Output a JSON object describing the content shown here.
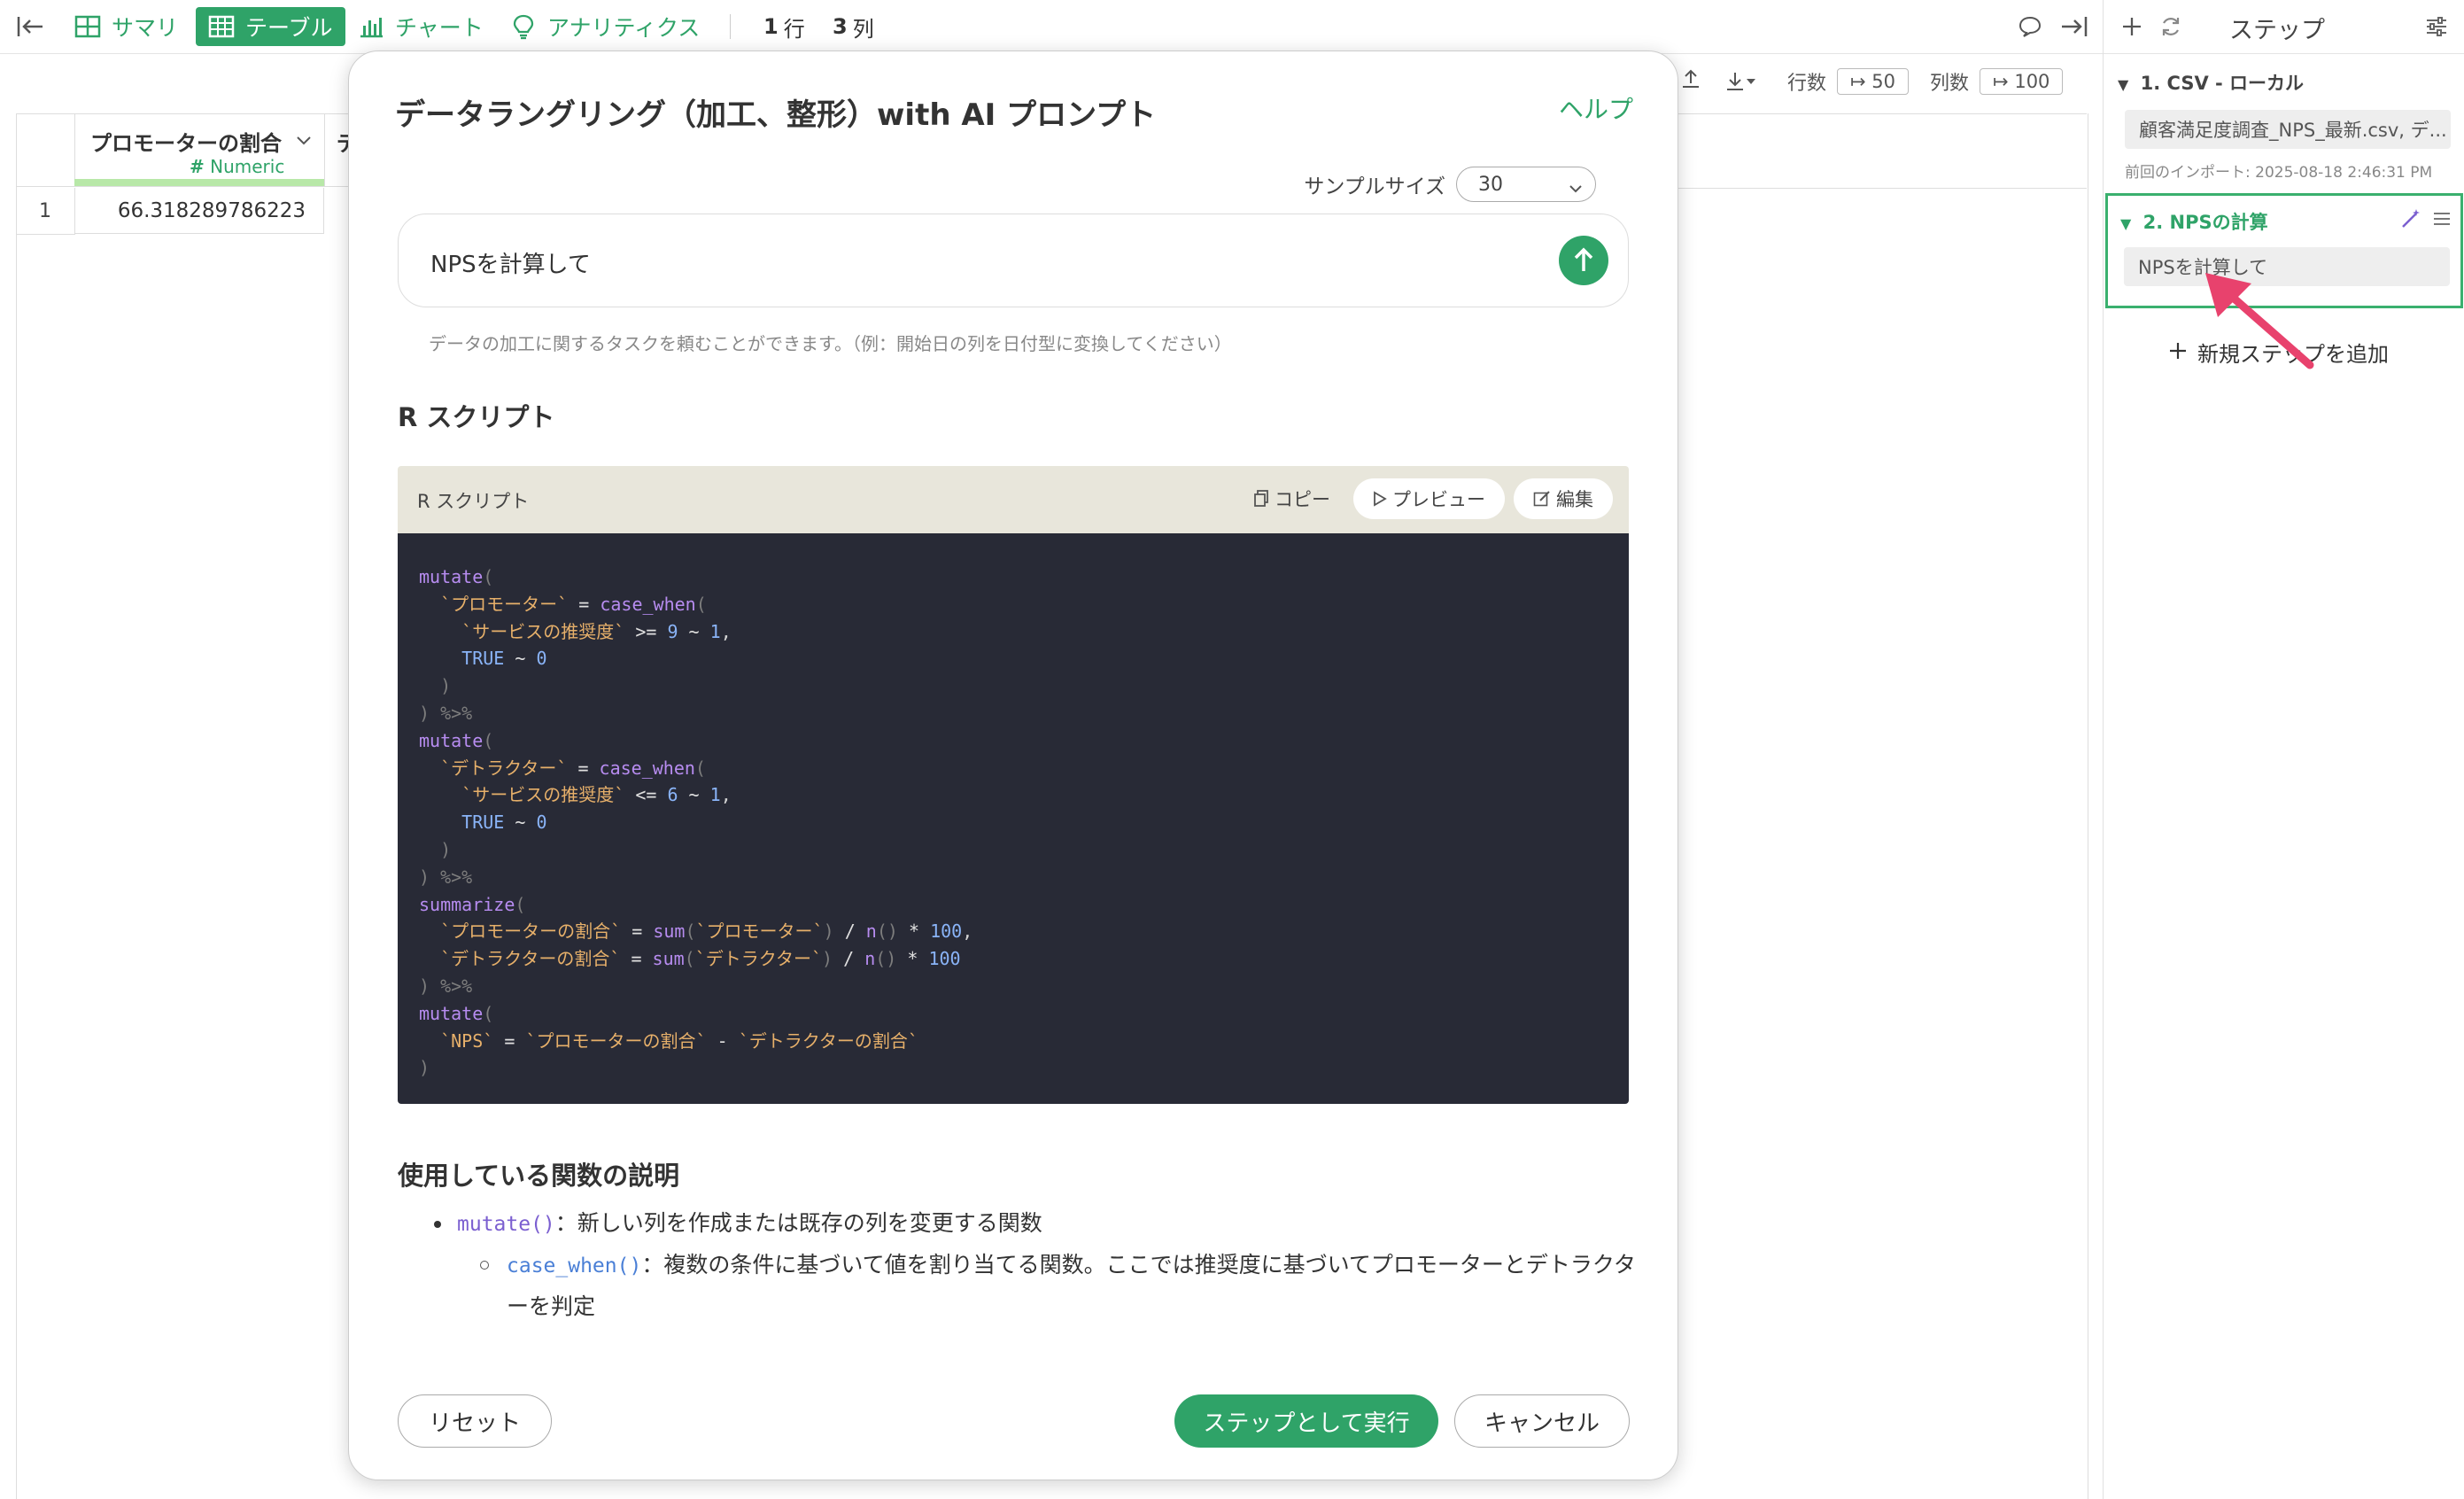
{
  "toolbar": {
    "summary_label": "サマリ",
    "table_label": "テーブル",
    "chart_label": "チャート",
    "analytics_label": "アナリティクス",
    "rows_value": "1",
    "rows_unit": "行",
    "cols_value": "3",
    "cols_unit": "列"
  },
  "table": {
    "row_count_label": "行数",
    "row_count_value": "50",
    "col_count_label": "列数",
    "col_count_value": "100",
    "column": {
      "name": "プロモーターの割合",
      "type": "Numeric",
      "next_col_partial": "デ"
    },
    "rows": [
      {
        "index": "1",
        "value": "66.318289786223"
      }
    ]
  },
  "sidebar": {
    "title": "ステップ",
    "step1": {
      "title": "1. CSV - ローカル",
      "file": "顧客満足度調査_NPS_最新.csv, デ...",
      "timestamp": "前回のインポート: 2025-08-18 2:46:31 PM"
    },
    "step2": {
      "title": "2. NPSの計算",
      "prompt": "NPSを計算して"
    },
    "add_step_label": "新規ステップを追加"
  },
  "modal": {
    "title": "データラングリング（加工、整形）with AI プロンプト",
    "help_label": "ヘルプ",
    "sample_size_label": "サンプルサイズ",
    "sample_size_value": "30",
    "prompt_text": "NPSを計算して",
    "prompt_hint": "データの加工に関するタスクを頼むことができます。（例：開始日の列を日付型に変換してください）",
    "script_section_title": "R スクリプト",
    "code_header_title": "R スクリプト",
    "copy_label": "コピー",
    "preview_label": "プレビュー",
    "edit_label": "編集",
    "functions_section_title": "使用している関数の説明",
    "functions": {
      "mutate_name": "mutate()",
      "mutate_desc": "：新しい列を作成または既存の列を変更する関数",
      "case_when_name": "case_when()",
      "case_when_desc": "：複数の条件に基づいて値を割り当てる関数。ここでは推奨度に基づいてプロモーターとデトラクターを判定"
    },
    "reset_label": "リセット",
    "run_label": "ステップとして実行",
    "cancel_label": "キャンセル"
  },
  "colors": {
    "accent": "#2fa368",
    "code_bg": "#282a36",
    "highlight_arrow": "#e8426d"
  }
}
